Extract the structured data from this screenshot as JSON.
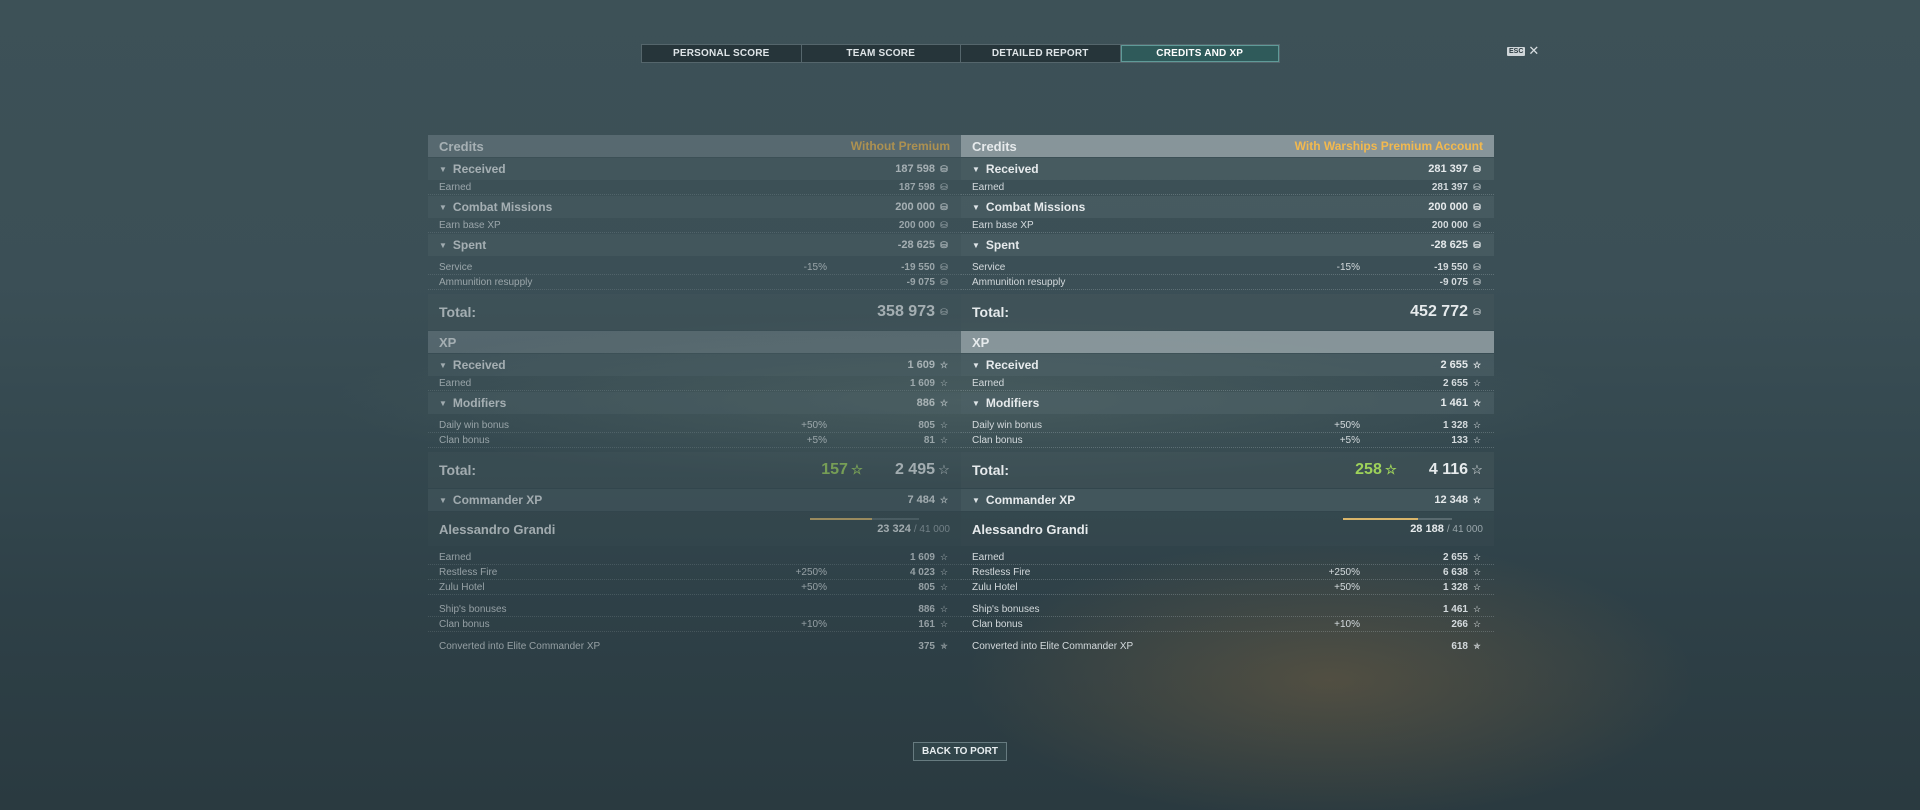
{
  "tabs": [
    "PERSONAL SCORE",
    "TEAM SCORE",
    "DETAILED REPORT",
    "CREDITS AND XP"
  ],
  "active_tab": "CREDITS AND XP",
  "esc_label": "ESC",
  "close_symbol": "✕",
  "back_button": "BACK TO PORT",
  "icons": {
    "credits": "credits-coin-icon",
    "xp": "xp-star-icon",
    "elite_xp": "elite-xp-icon"
  },
  "colors": {
    "premium_note": "#f3b94e",
    "bonus_green": "#9ed25a",
    "active_tab": "#2f5a5a"
  },
  "panels": [
    {
      "credits_title": "Credits",
      "note": "Without Premium",
      "received": {
        "label": "Received",
        "value": "187 598"
      },
      "earned": {
        "label": "Earned",
        "value": "187 598"
      },
      "combat_missions": {
        "label": "Combat Missions",
        "value": "200 000"
      },
      "earn_base_xp": {
        "label": "Earn base XP",
        "value": "200 000"
      },
      "spent": {
        "label": "Spent",
        "value": "-28 625"
      },
      "service": {
        "label": "Service",
        "pct": "-15%",
        "value": "-19 550"
      },
      "ammo": {
        "label": "Ammunition resupply",
        "value": "-9 075"
      },
      "credits_total": {
        "label": "Total:",
        "value": "358 973"
      },
      "xp_title": "XP",
      "xp_received": {
        "label": "Received",
        "value": "1 609"
      },
      "xp_earned": {
        "label": "Earned",
        "value": "1 609"
      },
      "modifiers": {
        "label": "Modifiers",
        "value": "886"
      },
      "daily_win": {
        "label": "Daily win bonus",
        "pct": "+50%",
        "value": "805"
      },
      "clan_bonus": {
        "label": "Clan bonus",
        "pct": "+5%",
        "value": "81"
      },
      "xp_total": {
        "label": "Total:",
        "bonus": "157",
        "value": "2 495"
      },
      "commander_xp": {
        "label": "Commander XP",
        "value": "7 484"
      },
      "commander": {
        "name": "Alessandro Grandi",
        "value": "23 324",
        "max": "/ 41 000",
        "progress": 0.569
      },
      "cmd_earned": {
        "label": "Earned",
        "value": "1 609"
      },
      "restless_fire": {
        "label": "Restless Fire",
        "pct": "+250%",
        "value": "4 023"
      },
      "zulu_hotel": {
        "label": "Zulu Hotel",
        "pct": "+50%",
        "value": "805"
      },
      "ships_bonuses": {
        "label": "Ship's bonuses",
        "value": "886"
      },
      "cmd_clan_bonus": {
        "label": "Clan bonus",
        "pct": "+10%",
        "value": "161"
      },
      "converted": {
        "label": "Converted into Elite Commander XP",
        "value": "375"
      }
    },
    {
      "credits_title": "Credits",
      "note": "With Warships Premium Account",
      "received": {
        "label": "Received",
        "value": "281 397"
      },
      "earned": {
        "label": "Earned",
        "value": "281 397"
      },
      "combat_missions": {
        "label": "Combat Missions",
        "value": "200 000"
      },
      "earn_base_xp": {
        "label": "Earn base XP",
        "value": "200 000"
      },
      "spent": {
        "label": "Spent",
        "value": "-28 625"
      },
      "service": {
        "label": "Service",
        "pct": "-15%",
        "value": "-19 550"
      },
      "ammo": {
        "label": "Ammunition resupply",
        "value": "-9 075"
      },
      "credits_total": {
        "label": "Total:",
        "value": "452 772"
      },
      "xp_title": "XP",
      "xp_received": {
        "label": "Received",
        "value": "2 655"
      },
      "xp_earned": {
        "label": "Earned",
        "value": "2 655"
      },
      "modifiers": {
        "label": "Modifiers",
        "value": "1 461"
      },
      "daily_win": {
        "label": "Daily win bonus",
        "pct": "+50%",
        "value": "1 328"
      },
      "clan_bonus": {
        "label": "Clan bonus",
        "pct": "+5%",
        "value": "133"
      },
      "xp_total": {
        "label": "Total:",
        "bonus": "258",
        "value": "4 116"
      },
      "commander_xp": {
        "label": "Commander XP",
        "value": "12 348"
      },
      "commander": {
        "name": "Alessandro Grandi",
        "value": "28 188",
        "max": "/ 41 000",
        "progress": 0.688
      },
      "cmd_earned": {
        "label": "Earned",
        "value": "2 655"
      },
      "restless_fire": {
        "label": "Restless Fire",
        "pct": "+250%",
        "value": "6 638"
      },
      "zulu_hotel": {
        "label": "Zulu Hotel",
        "pct": "+50%",
        "value": "1 328"
      },
      "ships_bonuses": {
        "label": "Ship's bonuses",
        "value": "1 461"
      },
      "cmd_clan_bonus": {
        "label": "Clan bonus",
        "pct": "+10%",
        "value": "266"
      },
      "converted": {
        "label": "Converted into Elite Commander XP",
        "value": "618"
      }
    }
  ]
}
